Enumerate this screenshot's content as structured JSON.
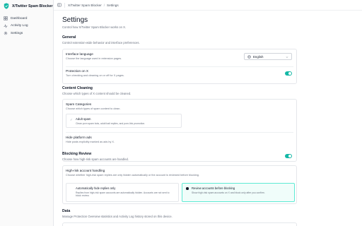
{
  "app": {
    "name": "X/Twitter Spam Blocker",
    "accent": "#14b8a6"
  },
  "sidebar": {
    "items": [
      {
        "label": "Dashboard",
        "icon": "dashboard-icon"
      },
      {
        "label": "Activity Log",
        "icon": "activity-icon"
      },
      {
        "label": "Settings",
        "icon": "gear-icon"
      }
    ]
  },
  "breadcrumb": {
    "root": "X/Twitter Spam Blocker",
    "separator": "/",
    "current": "Settings"
  },
  "page": {
    "title": "Settings",
    "description": "Control how X/Twitter Spam Blocker works on X."
  },
  "general": {
    "title": "General",
    "description": "Control extension-wide behavior and interface preferences.",
    "language": {
      "title": "Interface language",
      "description": "Choose the language used in extension pages.",
      "value": "English"
    },
    "protection": {
      "title": "Protection on X",
      "description": "Turn checking and cleaning on or off for X pages.",
      "enabled": true
    }
  },
  "content": {
    "title": "Content Cleaning",
    "description": "Choose which types of X content should be cleaned.",
    "categories": {
      "title": "Spam Categories",
      "description": "Choose which types of spam content to clean.",
      "adult": {
        "title": "Adult spam",
        "description": "Clean porn spam bots, adult bait replies, and porn-link promotion.",
        "checked": true
      }
    },
    "ads": {
      "title": "Hide platform ads",
      "description": "Hide posts explicitly marked as ads by X.",
      "enabled": true
    }
  },
  "blocking": {
    "title": "Blocking Review",
    "description": "Choose how high-risk spam accounts are handled.",
    "handling": {
      "title": "High-risk account handling",
      "description": "Choose whether high-risk spam replies are only hidden automatically or the account is reviewed before blocking.",
      "options": [
        {
          "title": "Automatically hide replies only",
          "description": "Replies from high-risk spam accounts are automatically hidden. Accounts are not sent to block review.",
          "selected": false
        },
        {
          "title": "Review accounts before blocking",
          "description": "Show high-risk spam accounts on X and block only after you confirm.",
          "selected": true
        }
      ]
    }
  },
  "data": {
    "title": "Data",
    "description": "Manage Protection Overview statistics and Activity Log history stored on this device."
  }
}
